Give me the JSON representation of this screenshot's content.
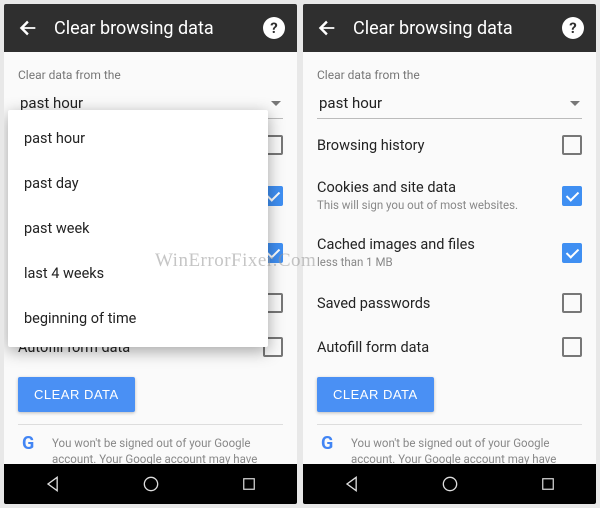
{
  "appbar": {
    "title": "Clear browsing data",
    "help": "?"
  },
  "hint": "Clear data from the",
  "dropdown": {
    "value": "past hour",
    "options": [
      "past hour",
      "past day",
      "past week",
      "last 4 weeks",
      "beginning of time"
    ]
  },
  "items": [
    {
      "label": "Browsing history",
      "sub": "",
      "checked": false
    },
    {
      "label": "Cookies and site data",
      "sub": "This will sign you out of most websites.",
      "checked": true
    },
    {
      "label": "Cached images and files",
      "sub": "less than 1 MB",
      "checked": true
    },
    {
      "label": "Saved passwords",
      "sub": "",
      "checked": false
    },
    {
      "label": "Autofill form data",
      "sub": "",
      "checked": false
    }
  ],
  "button": "CLEAR DATA",
  "footer": "You won't be signed out of your Google account. Your Google account may have other forms of browsing history at",
  "watermark": "WinErrorFixer.Com"
}
